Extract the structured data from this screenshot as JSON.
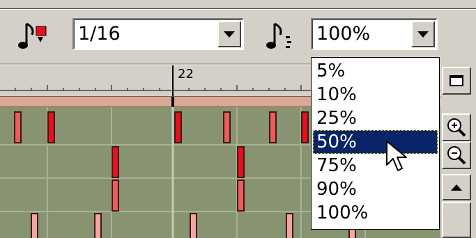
{
  "toolbar": {
    "snap_icon": "note-snap-icon",
    "snap_value": "1/16",
    "velocity_icon": "note-velocity-icon",
    "velocity_value": "100%"
  },
  "ruler": {
    "bar_label": "22"
  },
  "velocity_dropdown": {
    "options": [
      "5%",
      "10%",
      "25%",
      "50%",
      "75%",
      "90%",
      "100%"
    ],
    "selected": "50%"
  },
  "right_controls": {
    "window_icon": "window-icon",
    "zoom_in_icon": "zoom-in-icon",
    "zoom_out_icon": "zoom-out-icon",
    "scroll_up_icon": "scroll-up-arrow-icon"
  },
  "colors": {
    "grid_bg": "#889471",
    "note_bright": "#e8101a",
    "note_medium": "#ef5a5a",
    "note_pale": "#f3a4a4",
    "selection": "#0a246a"
  }
}
